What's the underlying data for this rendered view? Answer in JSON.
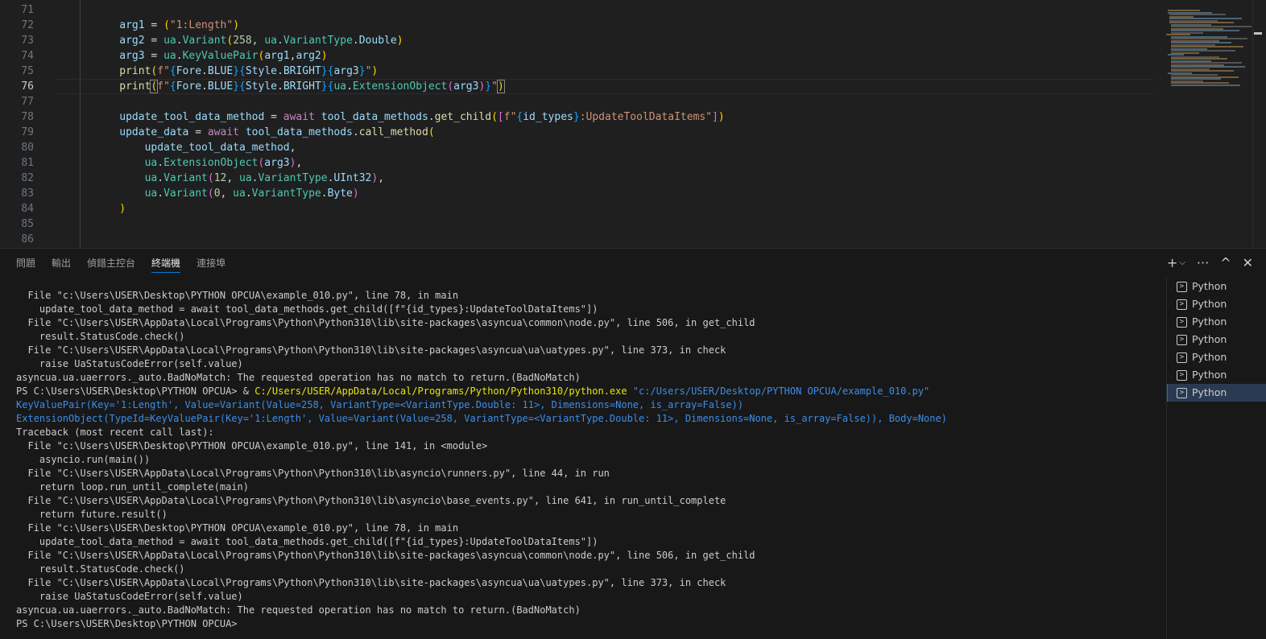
{
  "editor": {
    "line_numbers": [
      "71",
      "72",
      "73",
      "74",
      "75",
      "76",
      "77",
      "78",
      "79",
      "80",
      "81",
      "82",
      "83",
      "84",
      "85",
      "86"
    ],
    "active_line": "76"
  },
  "panel": {
    "tabs": [
      "問題",
      "輸出",
      "偵錯主控台",
      "終端機",
      "連接埠"
    ],
    "active_tab": "終端機",
    "sessions": [
      "Python",
      "Python",
      "Python",
      "Python",
      "Python",
      "Python",
      "Python"
    ],
    "selected_session": 6
  },
  "terminal": {
    "lines": [
      "  File \"c:\\Users\\USER\\Desktop\\PYTHON OPCUA\\example_010.py\", line 78, in main",
      "    update_tool_data_method = await tool_data_methods.get_child([f\"{id_types}:UpdateToolDataItems\"])",
      "  File \"C:\\Users\\USER\\AppData\\Local\\Programs\\Python\\Python310\\lib\\site-packages\\asyncua\\common\\node.py\", line 506, in get_child",
      "    result.StatusCode.check()",
      "  File \"C:\\Users\\USER\\AppData\\Local\\Programs\\Python\\Python310\\lib\\site-packages\\asyncua\\ua\\uatypes.py\", line 373, in check",
      "    raise UaStatusCodeError(self.value)",
      "asyncua.ua.uaerrors._auto.BadNoMatch: The requested operation has no match to return.(BadNoMatch)"
    ],
    "prompt": "PS C:\\Users\\USER\\Desktop\\PYTHON OPCUA> & ",
    "cmd_exe": "C:/Users/USER/AppData/Local/Programs/Python/Python310/python.exe",
    "cmd_arg": "\"c:/Users/USER/Desktop/PYTHON OPCUA/example_010.py\"",
    "blue_lines": [
      "KeyValuePair(Key='1:Length', Value=Variant(Value=258, VariantType=<VariantType.Double: 11>, Dimensions=None, is_array=False))",
      "ExtensionObject(TypeId=KeyValuePair(Key='1:Length', Value=Variant(Value=258, VariantType=<VariantType.Double: 11>, Dimensions=None, is_array=False)), Body=None)"
    ],
    "lines2": [
      "Traceback (most recent call last):",
      "  File \"c:\\Users\\USER\\Desktop\\PYTHON OPCUA\\example_010.py\", line 141, in <module>",
      "    asyncio.run(main())",
      "  File \"C:\\Users\\USER\\AppData\\Local\\Programs\\Python\\Python310\\lib\\asyncio\\runners.py\", line 44, in run",
      "    return loop.run_until_complete(main)",
      "  File \"C:\\Users\\USER\\AppData\\Local\\Programs\\Python\\Python310\\lib\\asyncio\\base_events.py\", line 641, in run_until_complete",
      "    return future.result()",
      "  File \"c:\\Users\\USER\\Desktop\\PYTHON OPCUA\\example_010.py\", line 78, in main",
      "    update_tool_data_method = await tool_data_methods.get_child([f\"{id_types}:UpdateToolDataItems\"])",
      "  File \"C:\\Users\\USER\\AppData\\Local\\Programs\\Python\\Python310\\lib\\site-packages\\asyncua\\common\\node.py\", line 506, in get_child",
      "    result.StatusCode.check()",
      "  File \"C:\\Users\\USER\\AppData\\Local\\Programs\\Python\\Python310\\lib\\site-packages\\asyncua\\ua\\uatypes.py\", line 373, in check",
      "    raise UaStatusCodeError(self.value)",
      "asyncua.ua.uaerrors._auto.BadNoMatch: The requested operation has no match to return.(BadNoMatch)",
      "PS C:\\Users\\USER\\Desktop\\PYTHON OPCUA>"
    ]
  },
  "code_tokens": {
    "l72": [
      "arg1",
      " = ",
      "(",
      "\"1:Length\"",
      ")"
    ],
    "l73": [
      "arg2",
      " = ",
      "ua",
      ".",
      "Variant",
      "(",
      "258",
      ", ",
      "ua",
      ".",
      "VariantType",
      ".",
      "Double",
      ")"
    ],
    "l74": [
      "arg3",
      " = ",
      "ua",
      ".",
      "KeyValuePair",
      "(",
      "arg1",
      ",",
      "arg2",
      ")"
    ],
    "l75": [
      "print",
      "(",
      "f\"",
      "{",
      "Fore",
      ".",
      "BLUE",
      "}",
      "{",
      "Style",
      ".",
      "BRIGHT",
      "}",
      "{",
      "arg3",
      "}",
      "\"",
      ")"
    ],
    "l76": [
      "print",
      "(",
      "f\"",
      "{",
      "Fore",
      ".",
      "BLUE",
      "}",
      "{",
      "Style",
      ".",
      "BRIGHT",
      "}",
      "{",
      "ua",
      ".",
      "ExtensionObject",
      "(",
      "arg3",
      ")",
      "}",
      "\"",
      ")"
    ],
    "l78": [
      "update_tool_data_method",
      " = ",
      "await",
      " ",
      "tool_data_methods",
      ".",
      "get_child",
      "(",
      "[",
      "f\"",
      "{",
      "id_types",
      "}",
      ":UpdateToolDataItems\"",
      "]",
      ")"
    ],
    "l79": [
      "update_data",
      " = ",
      "await",
      " ",
      "tool_data_methods",
      ".",
      "call_method",
      "("
    ],
    "l80": [
      "update_tool_data_method",
      ","
    ],
    "l81": [
      "ua",
      ".",
      "ExtensionObject",
      "(",
      "arg3",
      ")",
      ","
    ],
    "l82": [
      "ua",
      ".",
      "Variant",
      "(",
      "12",
      ", ",
      "ua",
      ".",
      "VariantType",
      ".",
      "UInt32",
      ")",
      ","
    ],
    "l83": [
      "ua",
      ".",
      "Variant",
      "(",
      "0",
      ", ",
      "ua",
      ".",
      "VariantType",
      ".",
      "Byte",
      ")"
    ],
    "l84": [
      ")"
    ]
  },
  "icons": {
    "new_terminal": "+",
    "dropdown": "⌵",
    "more": "···",
    "maximize": "^",
    "close": "✕",
    "terminal_glyph": ">"
  }
}
